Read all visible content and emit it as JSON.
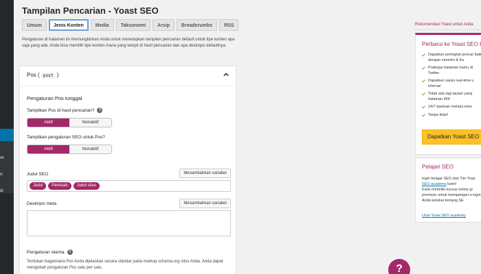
{
  "page": {
    "title": "Tampilan Pencarian - Yoast SEO"
  },
  "sidebar": {
    "label_1": "m",
    "label_2": "n",
    "label_3": "si"
  },
  "tabs": [
    {
      "label": "Umum"
    },
    {
      "label": "Jenis Konten"
    },
    {
      "label": "Media"
    },
    {
      "label": "Taksonomi"
    },
    {
      "label": "Arsip"
    },
    {
      "label": "Breadcrumbs"
    },
    {
      "label": "RSS"
    }
  ],
  "intro": "Pengaturan di halaman ini memungkinkan Anda untuk menetapkan tampilan pencarian default untuk tipe konten apa saja yang ada. Anda bisa memilih tipe konten mana yang tampil di hasil pencarian dan apa deskripsi defaultnya.",
  "panel": {
    "title": "Pos",
    "slug": "post",
    "section_title": "Pengaturan Pos tunggal",
    "show_in_results": {
      "label": "Tampilkan Pos di hasil pencarian?",
      "on": "Aktif",
      "off": "Nonaktif"
    },
    "show_seo": {
      "label": "Tampilkan pengaturan SEO untuk Pos?",
      "on": "Aktif",
      "off": "Nonaktif"
    },
    "seo_title": {
      "label": "Judul SEO",
      "button": "Menambahkan variabel",
      "chips": [
        "Judul",
        "Pemisah",
        "Judul situs"
      ]
    },
    "meta_desc": {
      "label": "Deskripsi meta",
      "button": "Menambahkan variabel"
    },
    "schema": {
      "label": "Pengaturan skema",
      "text": "Tentukan bagaimana Pos Anda dijelaskan secara standar pada markup schema.org situs Anda. Anda dapat mengubah pengaturan Pos satu per satu."
    }
  },
  "promo": {
    "label": "Rekomendasi Yoast untuk Anda",
    "card1": {
      "title": "Perbarui ke Yoast SEO P",
      "bullets": [
        "Dapatkan peringkat pencar baik dengan sinonim & fra",
        "Pratinjau halaman kamu di Twitter",
        "Dapatkan saran real-time u internal",
        "Tidak ada lagi tautan yang halaman 404",
        "24/7 bantuan melalui ema",
        "Tanpa iklan!"
      ],
      "button": "Dapatkan Yoast SEO P"
    },
    "card2": {
      "title": "Pelajari SEO",
      "text_1": "Ingin belajar SEO dari Tim Yoas",
      "link_1": "SEO academy",
      "text_2": " kami!",
      "text_3": "Kami memiliki kursus online gr premium untuk mempelajari a ingin Anda ketahui tentang SE",
      "foot_link": "Lihat Yoast SEO academy"
    }
  },
  "help_button": "?"
}
